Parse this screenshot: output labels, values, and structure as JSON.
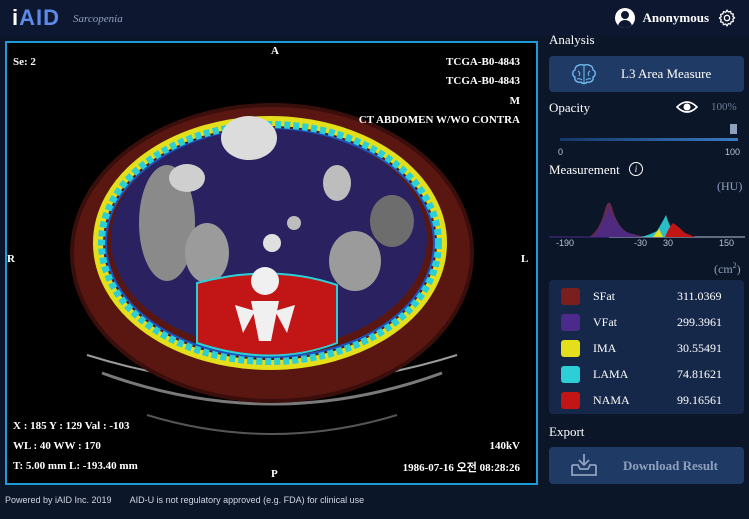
{
  "app": {
    "logo_prefix": "i",
    "logo_main": "AID",
    "subtitle": "Sarcopenia"
  },
  "header": {
    "username": "Anonymous",
    "user_icon": "user-circle-icon",
    "settings_icon": "gear-icon"
  },
  "viewer": {
    "series": "Se: 2",
    "patient_id_1": "TCGA-B0-4843",
    "patient_id_2": "TCGA-B0-4843",
    "sex": "M",
    "study": "CT ABDOMEN W/WO CONTRA",
    "orient_top": "A",
    "orient_bottom": "P",
    "orient_left": "R",
    "orient_right": "L",
    "cursor_info": "X : 185 Y : 129 Val : -103",
    "window_info": "WL : 40 WW : 170",
    "slice_info": "T: 5.00 mm L: -193.40 mm",
    "kv": "140kV",
    "datetime": "1986-07-16 오전 08:28:26"
  },
  "panel": {
    "analysis_title": "Analysis",
    "l3_button": "L3 Area Measure",
    "opacity_label": "Opacity",
    "opacity_value": "100%",
    "opacity_level": 1.0,
    "slider_min": "0",
    "slider_max": "100",
    "measurement_label": "Measurement",
    "hu_label": "(HU)",
    "hist_ticks": [
      "-190",
      "-30",
      "30",
      "150"
    ],
    "area_unit": "(cm",
    "area_unit_sup": "2",
    "area_unit_close": ")",
    "legend": [
      {
        "name": "SFat",
        "value": "311.0369",
        "color": "#7a1e1e"
      },
      {
        "name": "VFat",
        "value": "299.3961",
        "color": "#4b2a8c"
      },
      {
        "name": "IMA",
        "value": "30.55491",
        "color": "#e3df1a"
      },
      {
        "name": "LAMA",
        "value": "74.81621",
        "color": "#2ccfd6"
      },
      {
        "name": "NAMA",
        "value": "99.16561",
        "color": "#c21616"
      }
    ],
    "export_label": "Export",
    "download_button": "Download Result"
  },
  "footer": {
    "powered": "Powered by iAID Inc. 2019",
    "disclaimer": "AID-U is not regulatory approved (e.g. FDA) for clinical use"
  }
}
